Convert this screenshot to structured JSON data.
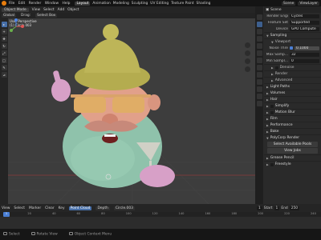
{
  "topbar": {
    "menu": [
      "File",
      "Edit",
      "Render",
      "Window",
      "Help"
    ],
    "workspaces": [
      "Layout",
      "Animation",
      "Modeling",
      "Sculpting",
      "UV Editing",
      "Texture Paint",
      "Shading"
    ],
    "active_workspace": "Layout",
    "scene": "Scene",
    "view_layer": "ViewLayer"
  },
  "viewport_header": {
    "mode": "Object Mode",
    "menus": [
      "View",
      "Select",
      "Add",
      "Object"
    ],
    "orientation": "Global",
    "drag_label": "Drag:",
    "drag_value": "Select Box"
  },
  "viewport": {
    "view_label": "User Perspective",
    "collection": "(1) Circle.003"
  },
  "timeline_header": {
    "menus": [
      "View",
      "Select",
      "Marker",
      "Clear",
      "Key"
    ],
    "keying_label": "Point Cloud",
    "mode_label": "Depth",
    "object": "Circle.003"
  },
  "frame_controls": {
    "current": "1",
    "start_label": "Start",
    "start": "1",
    "end_label": "End",
    "end": "250"
  },
  "timeline": {
    "ticks": [
      "0",
      "20",
      "40",
      "60",
      "80",
      "100",
      "120",
      "140",
      "160",
      "180",
      "200",
      "220",
      "240"
    ],
    "playhead": "1"
  },
  "statusbar": {
    "items": [
      "Select",
      "Rotate View",
      "Object Context Menu"
    ]
  },
  "properties": {
    "header": "Scene",
    "render_engine_label": "Render Engi",
    "render_engine": "Cycles",
    "feature_set_label": "Feature Set",
    "feature_set": "Supported",
    "device_label": "Device",
    "device": "GPU Compute",
    "sampling": "Sampling",
    "viewport": "Viewport",
    "noise_threshold_label": "Noise Thre",
    "noise_threshold": "0.1000",
    "max_samples_label": "Max Samp...",
    "max_samples": "32",
    "min_samples_label": "Min Sampl...",
    "min_samples": "0",
    "denoise": "Denoise",
    "render": "Render",
    "advanced": "Advanced",
    "light_paths": "Light Paths",
    "volumes": "Volumes",
    "hair": "Hair",
    "simplify": "Simplify",
    "motion_blur": "Motion Blur",
    "film": "Film",
    "performance": "Performance",
    "bake": "Bake",
    "polycorp": "PolyCorp Render",
    "select_pools": "Select Available Pools",
    "view_jobs": "View Jobs",
    "grease_pencil": "Grease Pencil",
    "freestyle": "Freestyle"
  }
}
